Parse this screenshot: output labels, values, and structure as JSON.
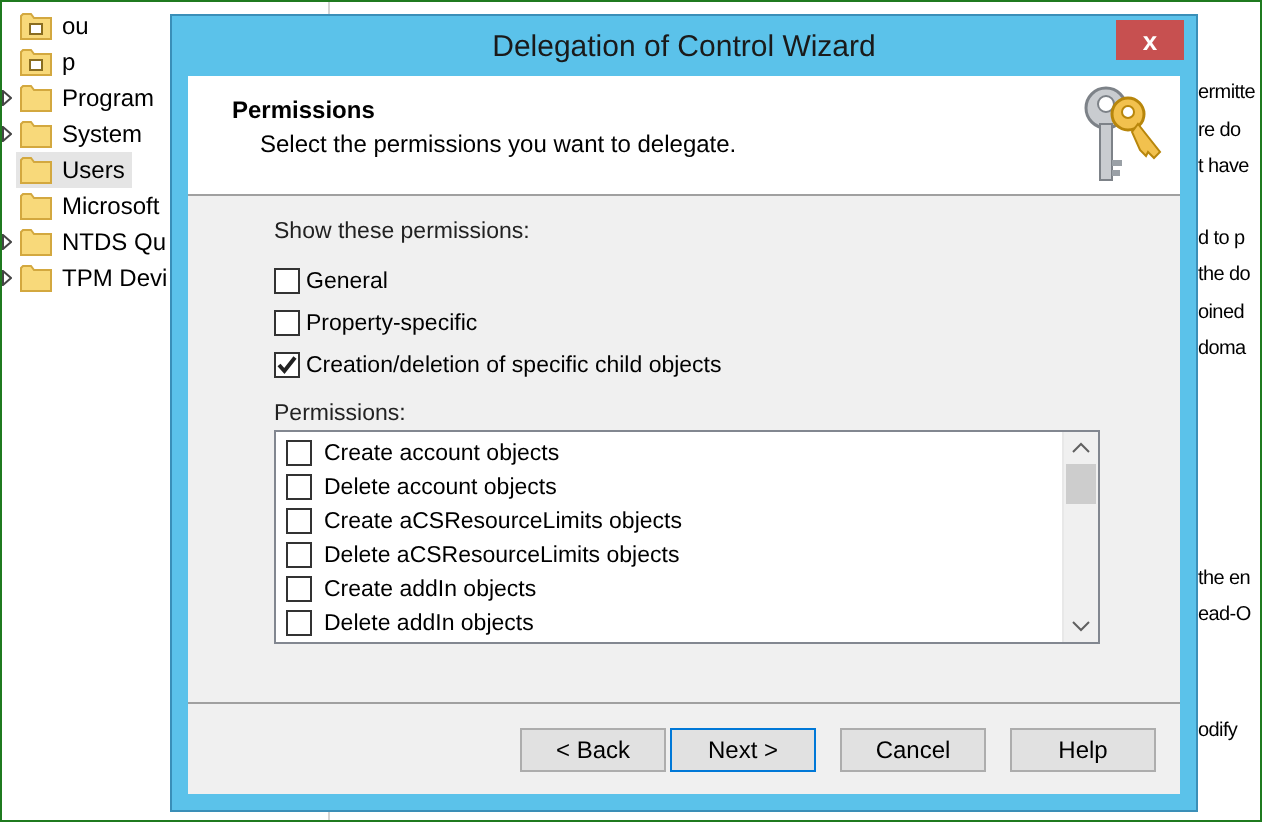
{
  "tree": {
    "items": [
      {
        "label": "ou",
        "kind": "ou",
        "expandable": false,
        "selected": false
      },
      {
        "label": "p",
        "kind": "ou",
        "expandable": false,
        "selected": false
      },
      {
        "label": "Program",
        "kind": "container",
        "expandable": true,
        "selected": false
      },
      {
        "label": "System",
        "kind": "container",
        "expandable": true,
        "selected": false
      },
      {
        "label": "Users",
        "kind": "container",
        "expandable": false,
        "selected": true
      },
      {
        "label": "Microsoft",
        "kind": "container",
        "expandable": false,
        "selected": false
      },
      {
        "label": "NTDS Qu",
        "kind": "container",
        "expandable": true,
        "selected": false
      },
      {
        "label": "TPM Devi",
        "kind": "container",
        "expandable": true,
        "selected": false
      }
    ]
  },
  "description_groups": [
    [
      "ermitte",
      "re do",
      "t have"
    ],
    [
      "d to p",
      "the do",
      "oined",
      "doma"
    ],
    [
      "the en",
      "ead-O"
    ],
    [
      "odify"
    ]
  ],
  "dialog": {
    "title": "Delegation of Control Wizard",
    "close": "x",
    "header": {
      "title": "Permissions",
      "subtitle": "Select the permissions you want to delegate."
    },
    "show_label": "Show these permissions:",
    "filters": [
      {
        "label": "General",
        "checked": false
      },
      {
        "label": "Property-specific",
        "checked": false
      },
      {
        "label": "Creation/deletion of specific child objects",
        "checked": true
      }
    ],
    "permissions_label": "Permissions:",
    "permissions": [
      {
        "label": "Create account objects",
        "checked": false
      },
      {
        "label": "Delete account objects",
        "checked": false
      },
      {
        "label": "Create aCSResourceLimits objects",
        "checked": false
      },
      {
        "label": "Delete aCSResourceLimits objects",
        "checked": false
      },
      {
        "label": "Create addIn objects",
        "checked": false
      },
      {
        "label": "Delete addIn objects",
        "checked": false
      }
    ],
    "buttons": [
      {
        "label": "< Back",
        "default": false
      },
      {
        "label": "Next >",
        "default": true
      },
      {
        "label": "Cancel",
        "default": false
      },
      {
        "label": "Help",
        "default": false
      }
    ]
  }
}
